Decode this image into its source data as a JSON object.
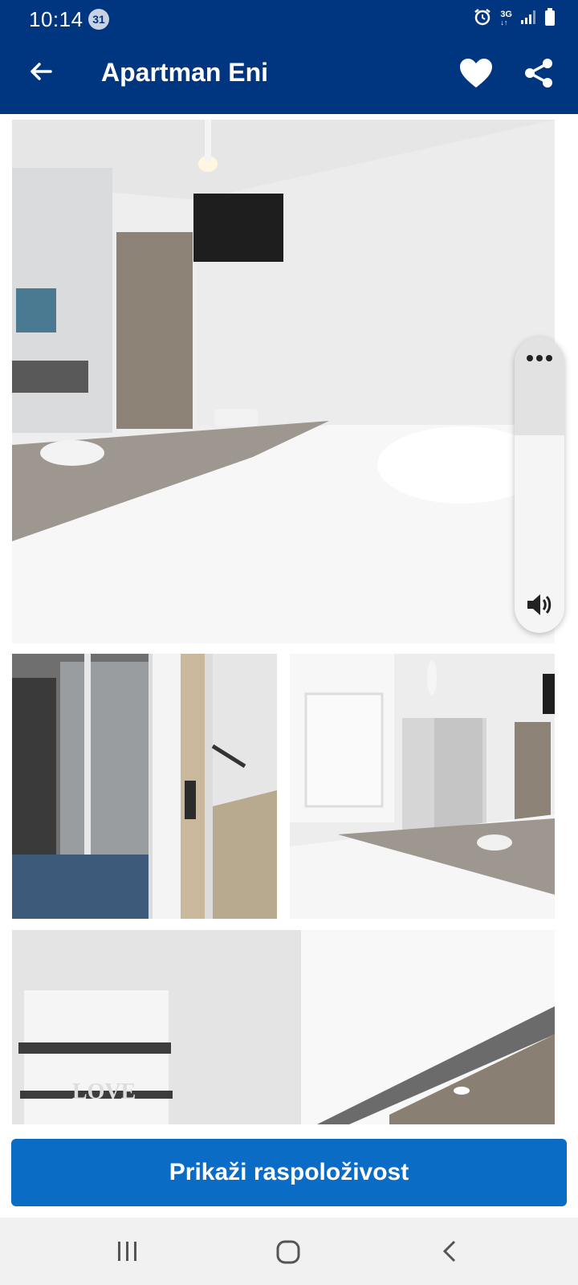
{
  "status_bar": {
    "time": "10:14",
    "notification_count": "31",
    "network": "3G",
    "icons": [
      "alarm-icon",
      "network-3g-icon",
      "signal-icon",
      "battery-icon"
    ]
  },
  "app_bar": {
    "title": "Apartman Eni",
    "icons": [
      "back-arrow-icon",
      "heart-icon",
      "share-icon"
    ]
  },
  "gallery": {
    "photos": [
      {
        "subject": "bedroom-main"
      },
      {
        "subject": "elevator-hallway"
      },
      {
        "subject": "bedroom-window-wardrobe"
      },
      {
        "subject": "kitchen"
      }
    ]
  },
  "volume_panel": {
    "icons": [
      "more-options-icon",
      "speaker-icon"
    ]
  },
  "cta": {
    "label": "Prikaži raspoloživost"
  },
  "nav_bar": {
    "icons": [
      "recents-icon",
      "home-icon",
      "back-chevron-icon"
    ]
  },
  "colors": {
    "brand": "#003580",
    "cta": "#0a6cc4",
    "navbar": "#f1f1f1"
  }
}
